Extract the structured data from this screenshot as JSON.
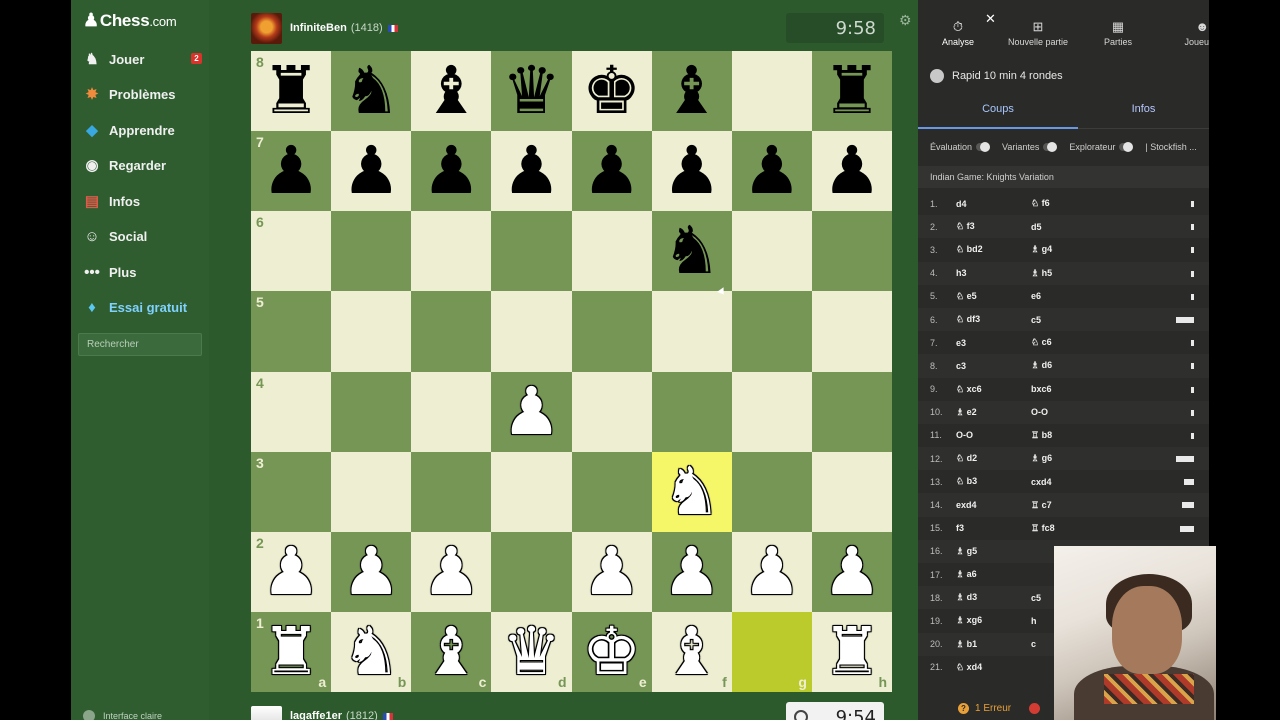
{
  "leftnav": {
    "logo_main": "Chess",
    "logo_suffix": ".com",
    "items": [
      {
        "label": "Jouer",
        "icon": "play-icon",
        "badge": "2"
      },
      {
        "label": "Problèmes",
        "icon": "puzzle-icon"
      },
      {
        "label": "Apprendre",
        "icon": "learn-icon"
      },
      {
        "label": "Regarder",
        "icon": "watch-icon"
      },
      {
        "label": "Infos",
        "icon": "news-icon"
      },
      {
        "label": "Social",
        "icon": "social-icon"
      },
      {
        "label": "Plus",
        "icon": "more-icon"
      },
      {
        "label": "Essai gratuit",
        "icon": "diamond-icon"
      }
    ],
    "search_placeholder": "Rechercher",
    "bottom_label": "Interface claire"
  },
  "top_player": {
    "name": "InfiniteBen",
    "rating": "(1418)",
    "clock": "9:58"
  },
  "bottom_player": {
    "name": "lagaffe1er",
    "rating": "(1812)",
    "clock": "9:54"
  },
  "board": {
    "orientation": "white",
    "ranks": [
      "8",
      "7",
      "6",
      "5",
      "4",
      "3",
      "2",
      "1"
    ],
    "files": [
      "a",
      "b",
      "c",
      "d",
      "e",
      "f",
      "g",
      "h"
    ],
    "position": [
      [
        "br",
        "bn",
        "bb",
        "bq",
        "bk",
        "bb",
        "",
        "br"
      ],
      [
        "bp",
        "bp",
        "bp",
        "bp",
        "bp",
        "bp",
        "bp",
        "bp"
      ],
      [
        "",
        "",
        "",
        "",
        "",
        "bn",
        "",
        ""
      ],
      [
        "",
        "",
        "",
        "",
        "",
        "",
        "",
        ""
      ],
      [
        "",
        "",
        "",
        "wp",
        "",
        "",
        "",
        ""
      ],
      [
        "",
        "",
        "",
        "",
        "",
        "wn",
        "",
        ""
      ],
      [
        "wp",
        "wp",
        "wp",
        "",
        "wp",
        "wp",
        "wp",
        "wp"
      ],
      [
        "wr",
        "wn",
        "wb",
        "wq",
        "wk",
        "wb",
        "",
        "wr"
      ]
    ],
    "highlights": {
      "f3": "to",
      "g1": "from"
    }
  },
  "right": {
    "tabs": [
      {
        "label": "Analyse",
        "icon": "analysis-icon"
      },
      {
        "label": "Nouvelle partie",
        "icon": "new-game-icon"
      },
      {
        "label": "Parties",
        "icon": "games-icon"
      },
      {
        "label": "Joueu",
        "icon": "players-icon"
      }
    ],
    "close": "✕",
    "game_title": "Rapid 10 min 4 rondes",
    "subtabs": [
      "Coups",
      "Infos"
    ],
    "toggles": [
      "Évaluation",
      "Variantes",
      "Explorateur"
    ],
    "engine": "| Stockfish ...",
    "opening": "Indian Game: Knights Variation",
    "moves": [
      {
        "no": "1.",
        "w": "d4",
        "b": "♘ f6",
        "bar": 3
      },
      {
        "no": "2.",
        "w": "♘ f3",
        "b": "d5",
        "bar": 3
      },
      {
        "no": "3.",
        "w": "♘ bd2",
        "b": "♗ g4",
        "bar": 3
      },
      {
        "no": "4.",
        "w": "h3",
        "b": "♗ h5",
        "bar": 3
      },
      {
        "no": "5.",
        "w": "♘ e5",
        "b": "e6",
        "bar": 3
      },
      {
        "no": "6.",
        "w": "♘ df3",
        "b": "c5",
        "bar": 18
      },
      {
        "no": "7.",
        "w": "e3",
        "b": "♘ c6",
        "bar": 3
      },
      {
        "no": "8.",
        "w": "c3",
        "b": "♗ d6",
        "bar": 3
      },
      {
        "no": "9.",
        "w": "♘ xc6",
        "b": "bxc6",
        "bar": 3
      },
      {
        "no": "10.",
        "w": "♗ e2",
        "b": "O-O",
        "bar": 3
      },
      {
        "no": "11.",
        "w": "O-O",
        "b": "♖ b8",
        "bar": 3
      },
      {
        "no": "12.",
        "w": "♘ d2",
        "b": "♗ g6",
        "bar": 18
      },
      {
        "no": "13.",
        "w": "♘ b3",
        "b": "cxd4",
        "bar": 10
      },
      {
        "no": "14.",
        "w": "exd4",
        "b": "♖ c7",
        "bar": 12
      },
      {
        "no": "15.",
        "w": "f3",
        "b": "♖ fc8",
        "bar": 14
      },
      {
        "no": "16.",
        "w": "♗ g5",
        "b": "",
        "bar": 0
      },
      {
        "no": "17.",
        "w": "♗ a6",
        "b": "",
        "bar": 0
      },
      {
        "no": "18.",
        "w": "♗ d3",
        "b": "c5",
        "bar": 0
      },
      {
        "no": "19.",
        "w": "♗ xg6",
        "b": "h",
        "bar": 0
      },
      {
        "no": "20.",
        "w": "♗ b1",
        "b": "c",
        "bar": 0
      },
      {
        "no": "21.",
        "w": "♘ xd4",
        "b": "",
        "bar": 0
      }
    ],
    "errors": "1 Erreur"
  }
}
